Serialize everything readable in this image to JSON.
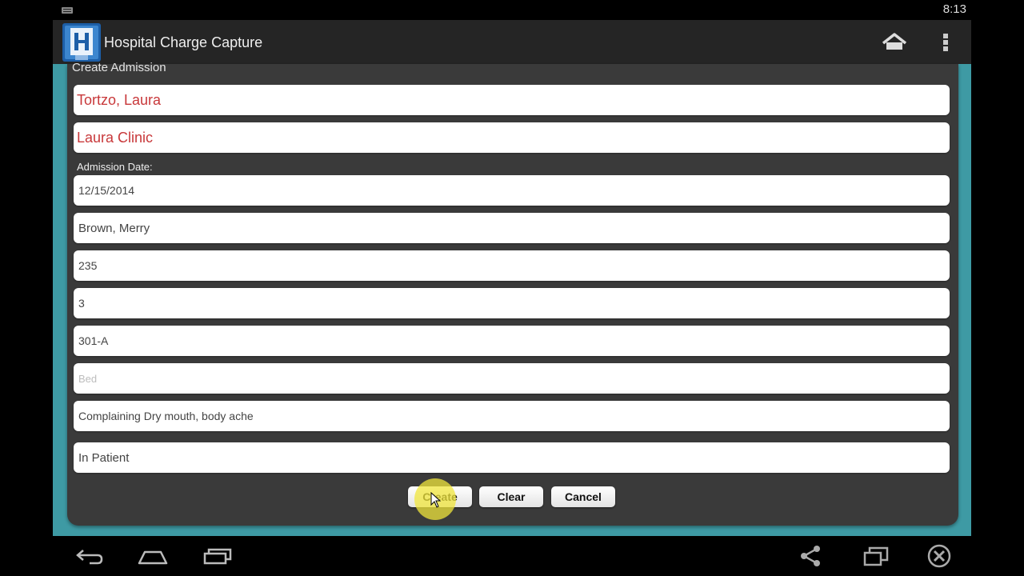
{
  "status_bar": {
    "time": "8:13",
    "left_icon": "keyboard-icon"
  },
  "action_bar": {
    "logo_icon": "hospital-h-logo-icon",
    "title": "Hospital Charge Capture",
    "home_icon": "home-icon",
    "overflow_icon": "overflow-menu-icon"
  },
  "form": {
    "heading": "Create Admission",
    "patient": "Tortzo, Laura",
    "clinic": "Laura Clinic",
    "admission_date_label": "Admission Date:",
    "admission_date": "12/15/2014",
    "physician": "Brown, Merry",
    "field_235": "235",
    "field_3": "3",
    "room": "301-A",
    "bed_placeholder": "Bed",
    "complaint": "Complaining Dry mouth, body ache",
    "patient_type": "In Patient"
  },
  "buttons": {
    "create": "Create",
    "clear": "Clear",
    "cancel": "Cancel"
  },
  "navigation": {
    "back_icon": "back-icon",
    "home_icon": "home-icon",
    "recents_icon": "recent-apps-icon",
    "share_icon": "share-icon",
    "window_icon": "window-icon",
    "close_icon": "close-icon"
  },
  "colors": {
    "accent_teal": "#3e9aa4",
    "name_red": "#c8383a",
    "panel": "#3a3a3a"
  }
}
